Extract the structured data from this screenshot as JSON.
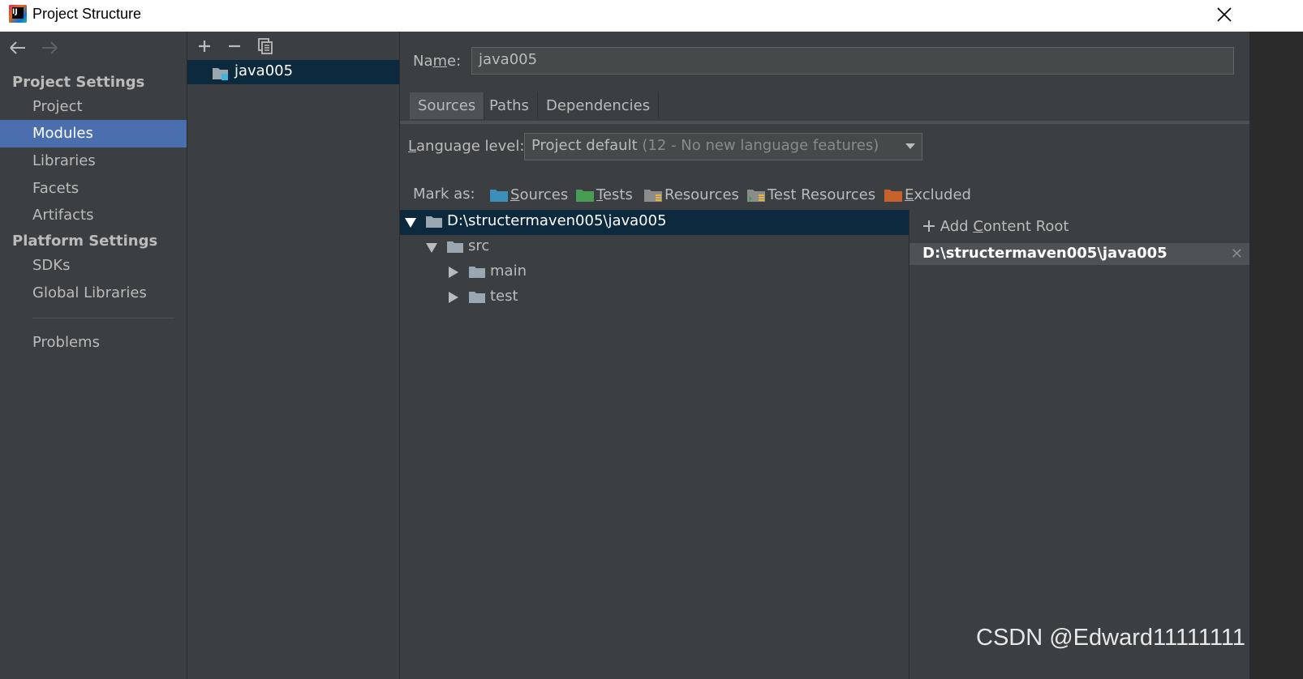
{
  "window": {
    "title": "Project Structure",
    "close_icon": "close-icon"
  },
  "nav": {
    "back_icon": "arrow-left-icon",
    "forward_icon": "arrow-right-icon",
    "project_settings_header": "Project Settings",
    "project_items": [
      "Project",
      "Modules",
      "Libraries",
      "Facets",
      "Artifacts"
    ],
    "platform_settings_header": "Platform Settings",
    "platform_items": [
      "SDKs",
      "Global Libraries"
    ],
    "problems": "Problems",
    "selected": "Modules",
    "selected_color": "#4b6eaf"
  },
  "modules": {
    "toolbar": [
      "add-icon",
      "remove-icon",
      "copy-icon"
    ],
    "items": [
      "java005"
    ]
  },
  "main": {
    "name_label": "Name:",
    "name_value": "java005",
    "tabs": [
      "Sources",
      "Paths",
      "Dependencies"
    ],
    "selected_tab": "Sources",
    "language_level_label": "Language level:",
    "language_level_value": "Project default",
    "language_level_hint": "(12 - No new language features)",
    "mark_as_label": "Mark as:",
    "mark_as": [
      {
        "label": "Sources",
        "color": "#3d8eb9"
      },
      {
        "label": "Tests",
        "color": "#499c54"
      },
      {
        "label": "Resources",
        "color": "#8c8c8c"
      },
      {
        "label": "Test Resources",
        "color": "#8c8c8c"
      },
      {
        "label": "Excluded",
        "color": "#c7622d"
      }
    ]
  },
  "tree": {
    "root": "D:\\structermaven005\\java005",
    "src": "src",
    "main": "main",
    "test": "test"
  },
  "content_root": {
    "add_label": "Add Content Root",
    "path": "D:\\structermaven005\\java005",
    "remove_icon": "close-icon"
  },
  "watermark": "CSDN @Edward11111111"
}
